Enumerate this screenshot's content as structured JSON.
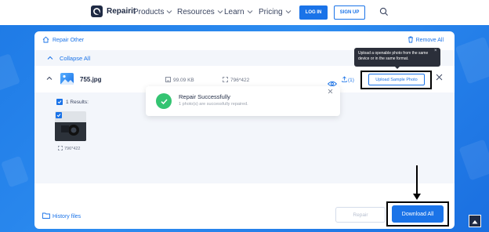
{
  "nav": {
    "brand": "Repairit",
    "items": [
      {
        "label": "Products"
      },
      {
        "label": "Resources"
      },
      {
        "label": "Learn"
      },
      {
        "label": "Pricing"
      }
    ],
    "login_label": "LOG IN",
    "signup_label": "SIGN UP"
  },
  "card": {
    "repair_other": "Repair Other",
    "remove_all": "Remove All",
    "collapse_all": "Collapse All",
    "file": {
      "name": "755.jpg",
      "size": "99.09 KB",
      "dims": "796*422",
      "count": "(1)",
      "upload_sample_label": "Upload Sample Photo"
    },
    "results": {
      "label": "1 Results:",
      "thumb_dims": "796*422"
    },
    "history_label": "History files",
    "repair_label": "Repair",
    "download_label": "Download All"
  },
  "toast": {
    "title": "Repair Successfully",
    "subtitle": "1 photo(s) are successfully repaired."
  },
  "tooltip": {
    "text": "Upload a openable photo from the same device or in the same format."
  },
  "colors": {
    "accent": "#1a73e8",
    "success": "#34c472",
    "background_blue": "#2d8cf0",
    "nav_dark": "#1f2a44"
  },
  "icons": [
    "repairit-logo-icon",
    "chevron-down-icon",
    "search-icon",
    "home-icon",
    "trash-icon",
    "chevron-up-icon",
    "image-icon",
    "file-size-icon",
    "dimensions-icon",
    "eye-icon",
    "upload-icon",
    "close-icon",
    "checkbox-icon",
    "check-circle-icon",
    "folder-icon",
    "arrow-up-icon"
  ]
}
